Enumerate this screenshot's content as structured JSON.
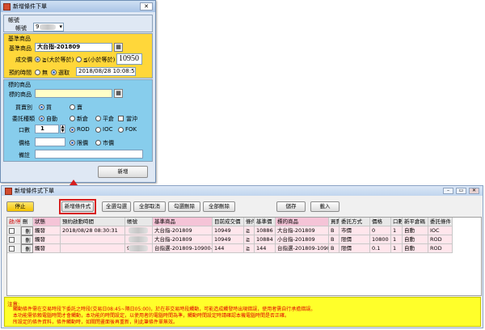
{
  "dialog": {
    "title": "新增條件下單",
    "account_group": "帳號",
    "account_label": "帳號",
    "account_value": "9",
    "base_group": "基準商品",
    "base_label": "基準商品",
    "base_value": "大台指-201809",
    "price_label": "成交價",
    "opt_gte": "≧(大於等於)",
    "opt_lte": "≦(小於等於)",
    "price_value": "10950",
    "schedule_label": "預約時間",
    "opt_none": "無",
    "opt_select": "選取",
    "schedule_value": "2018/08/28 10:08:50",
    "target_group": "標的商品",
    "target_label": "標的商品",
    "target_value": "",
    "side_label": "買賣別",
    "opt_buy": "買",
    "opt_sell": "賣",
    "order_type_label": "委託種類",
    "opt_auto": "自動",
    "opt_new": "新倉",
    "opt_close": "平倉",
    "opt_daytrade": "當沖",
    "qty_label": "口數",
    "qty_value": "1",
    "opt_rod": "ROD",
    "opt_ioc": "IOC",
    "opt_fok": "FOK",
    "price2_label": "價格",
    "opt_limit": "限價",
    "opt_market": "市價",
    "remark_label": "備註",
    "add_button": "新增",
    "close_glyph": "✕",
    "lookup_glyph": "▦",
    "dropdown_glyph": "▾",
    "spin_up": "▲",
    "spin_down": "▼"
  },
  "main": {
    "title": "新增條件式下單",
    "win_min": "–",
    "win_max": "▭",
    "win_close": "✕",
    "toolbar": {
      "stop": "停止",
      "new_condition": "新增條件式",
      "select_all": "全選勾選",
      "cancel_all": "全部取消",
      "delete_checked": "勾選刪除",
      "delete_all": "全部刪除",
      "save": "儲存",
      "load": "載入"
    },
    "columns": [
      "啟/停",
      "刪",
      "狀態",
      "預約啟動時間",
      "帳號",
      "基準商品",
      "目前成交價",
      "條件",
      "基準價",
      "標的商品",
      "買賣",
      "委託方式",
      "價格",
      "口數",
      "新平倉碼",
      "委託條件"
    ],
    "rows": [
      [
        "",
        "刪",
        "觸發",
        "2018/08/28 08:30:31",
        "",
        "大台指-201809",
        "10949",
        "≧",
        "10886",
        "大台指-201809",
        "B",
        "市價",
        "0",
        "1",
        "自動",
        "IOC"
      ],
      [
        "",
        "刪",
        "觸發",
        "",
        "",
        "大台指-201809",
        "10949",
        "≧",
        "10884",
        "小台指-201809",
        "B",
        "限價",
        "10800",
        "1",
        "自動",
        "ROD"
      ],
      [
        "",
        "刪",
        "觸發",
        "",
        "9",
        "台指選-201809-10900-C",
        "144",
        "≧",
        "144",
        "台指選-201809-10900-C",
        "B",
        "限價",
        "0.1",
        "1",
        "自動",
        "ROD"
      ]
    ],
    "note_title": "注意:",
    "note_lines": [
      "觸動條件需在交易時段下委託之時段(交易日08:45~隔日05:00)，於在非交易時段觸動，可能造成觸發時出現錯誤，使用者需自行承擔錯誤。",
      "本功能需依賴電腦時間才會觸動，本功能的時間設定，以使用者的電腦時間為準，觸動時間設定時請確認本機電腦時間是否正確。",
      "所設定的條件資料，條件觸動時，如關閉畫面後再重新，則此筆條件單無效。"
    ]
  },
  "colors": {
    "dialog_top_section": "#ffd73a",
    "dialog_bottom_section": "#87cdec",
    "row_pink": "#ffe6ec",
    "header_pink": "#f5c4d7",
    "note_yellow": "#ffff2a",
    "note_red": "#e00000",
    "highlight_red": "#d71f1f"
  }
}
